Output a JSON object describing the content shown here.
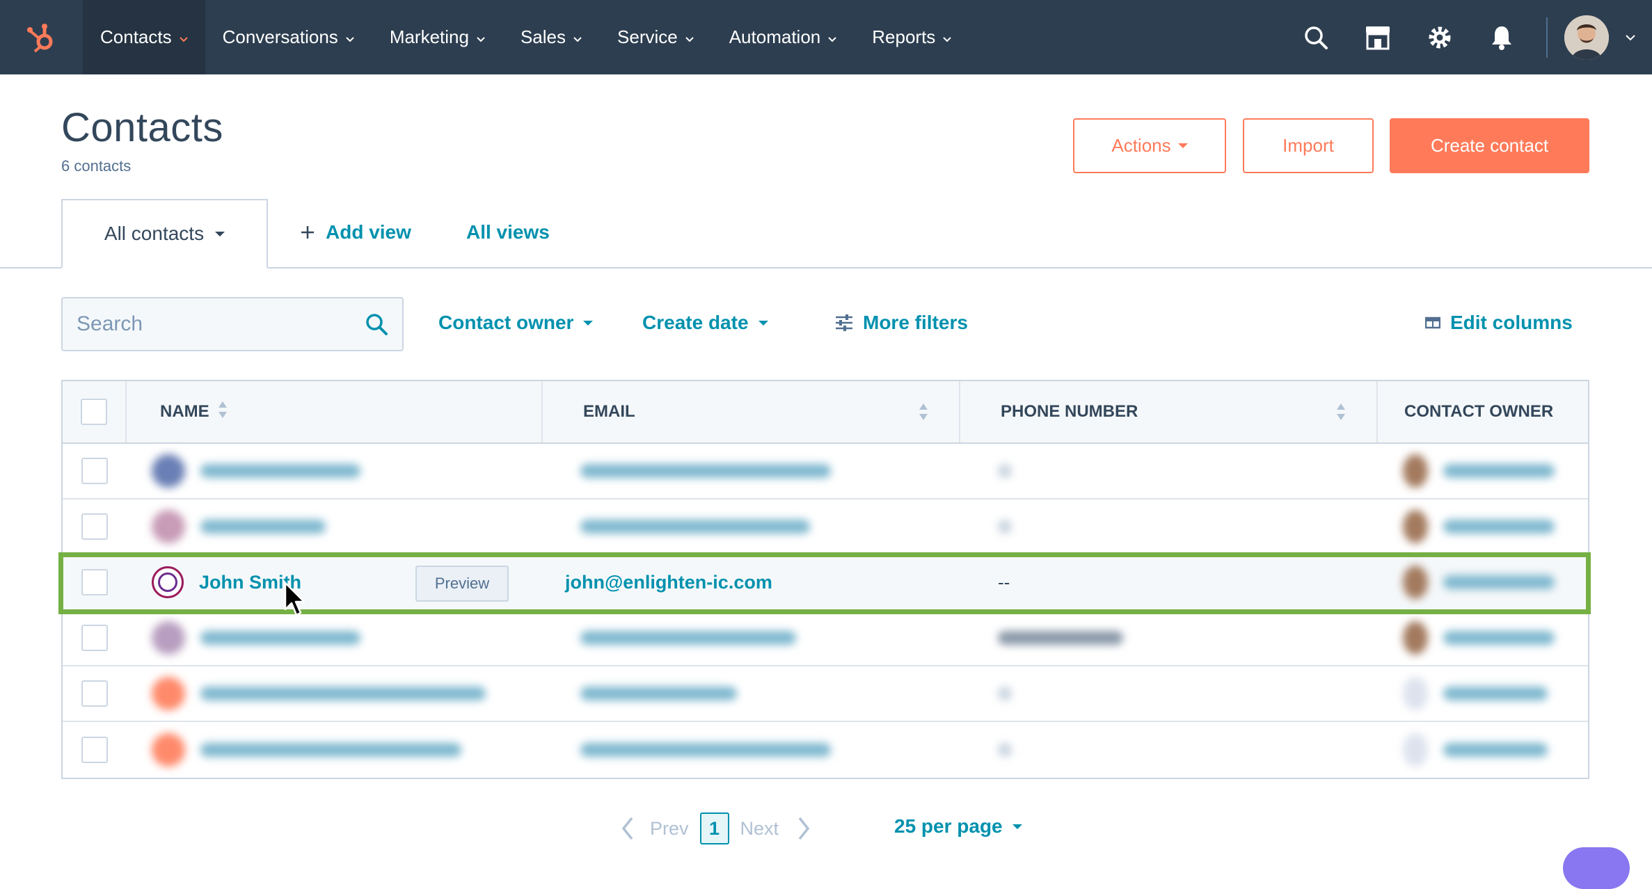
{
  "topnav": {
    "items": [
      {
        "label": "Contacts",
        "active": true
      },
      {
        "label": "Conversations"
      },
      {
        "label": "Marketing"
      },
      {
        "label": "Sales"
      },
      {
        "label": "Service"
      },
      {
        "label": "Automation"
      },
      {
        "label": "Reports"
      }
    ],
    "icons": [
      "search-icon",
      "marketplace-icon",
      "gear-icon",
      "bell-icon"
    ],
    "brand_color": "#ff7a59",
    "bg_color": "#2d3e50"
  },
  "header": {
    "title": "Contacts",
    "subtitle": "6 contacts",
    "actions_label": "Actions",
    "import_label": "Import",
    "create_label": "Create contact"
  },
  "views": {
    "current": "All contacts",
    "add_view": "Add view",
    "all_views": "All views"
  },
  "filters": {
    "search_placeholder": "Search",
    "contact_owner": "Contact owner",
    "create_date": "Create date",
    "more_filters": "More filters",
    "edit_columns": "Edit columns"
  },
  "table": {
    "columns": [
      "NAME",
      "EMAIL",
      "PHONE NUMBER",
      "CONTACT OWNER"
    ],
    "highlighted_row": {
      "name": "John Smith",
      "email": "john@enlighten-ic.com",
      "phone": "--",
      "preview_label": "Preview"
    },
    "highlight_color": "#74b043"
  },
  "pagination": {
    "prev": "Prev",
    "page": "1",
    "next": "Next",
    "per_page": "25 per page"
  }
}
